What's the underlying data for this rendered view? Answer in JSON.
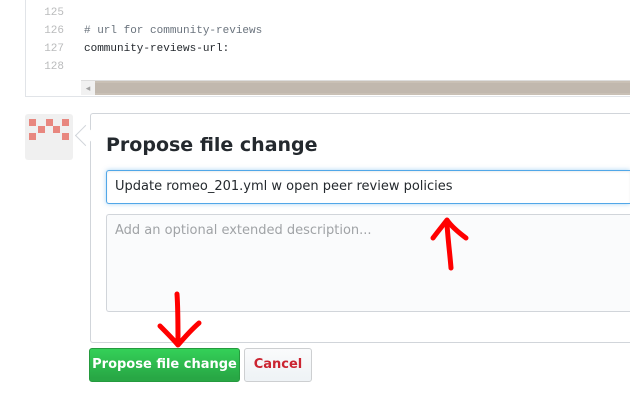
{
  "code": {
    "lines": [
      {
        "number": "125",
        "text": ""
      },
      {
        "number": "126",
        "text": "# url for community-reviews"
      },
      {
        "number": "127",
        "text": "community-reviews-url:"
      },
      {
        "number": "128",
        "text": ""
      }
    ]
  },
  "composer": {
    "title": "Propose file change",
    "summary_value": "Update romeo_201.yml w open peer review policies",
    "description_placeholder": "Add an optional extended description...",
    "submit_label": "Propose file change",
    "cancel_label": "Cancel"
  },
  "colors": {
    "accent_focus": "#51a7e8",
    "primary_button": "#28a745",
    "cancel_text": "#cb2431",
    "annotation": "#ff0000",
    "avatar_identicon": "#e8877f"
  },
  "icons": {
    "scroll_left": "◂"
  }
}
